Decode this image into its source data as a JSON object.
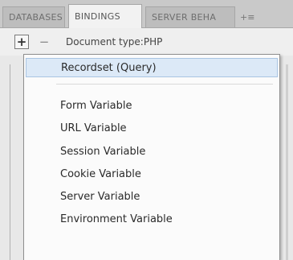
{
  "tabs": [
    {
      "label": "DATABASES",
      "active": false
    },
    {
      "label": "BINDINGS",
      "active": true
    },
    {
      "label": "SERVER BEHA",
      "active": false
    }
  ],
  "tab_overflow": "+≡",
  "toolbar": {
    "add_label": "+",
    "remove_label": "−",
    "document_type": "Document type:PHP"
  },
  "menu": {
    "items": [
      {
        "label": "Recordset (Query)",
        "highlighted": true
      },
      {
        "label": "Form Variable"
      },
      {
        "label": "URL Variable"
      },
      {
        "label": "Session Variable"
      },
      {
        "label": "Cookie Variable"
      },
      {
        "label": "Server Variable"
      },
      {
        "label": "Environment Variable"
      }
    ]
  },
  "colors": {
    "highlight_bg": "#dce9f7",
    "highlight_border": "#a9c4e2",
    "menu_bg": "#fbfbfb",
    "tabbar_bg": "#c9c9c9"
  }
}
